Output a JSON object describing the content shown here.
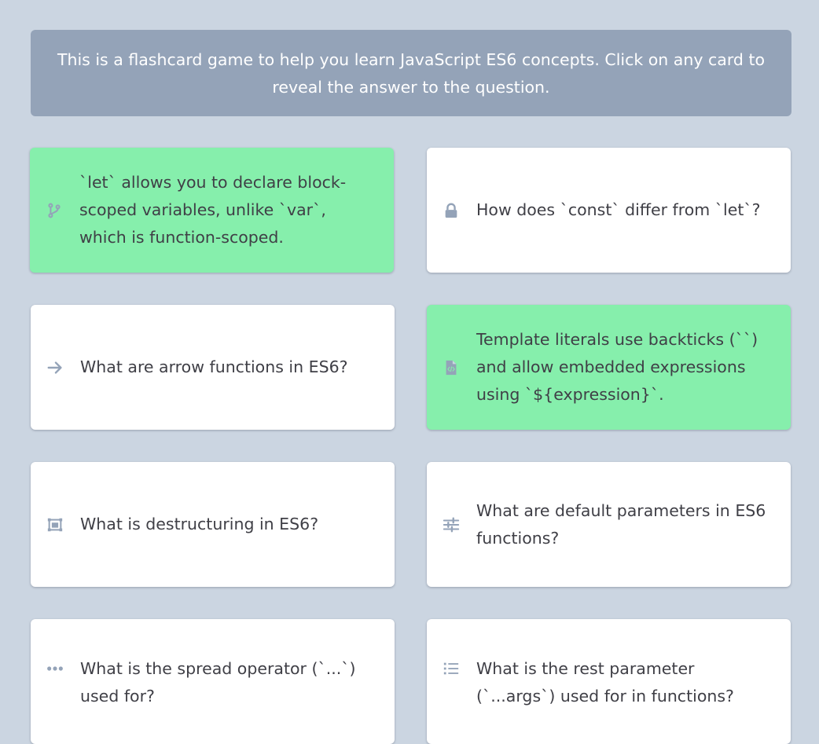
{
  "intro": {
    "text": "This is a flashcard game to help you learn JavaScript ES6 concepts. Click on any card to reveal the answer to the question."
  },
  "colors": {
    "background": "#cbd5e1",
    "banner": "#94a3b8",
    "card": "#ffffff",
    "card_revealed": "#86efac",
    "icon": "#94a3b8"
  },
  "cards": [
    {
      "icon": "git-branch-icon",
      "revealed": true,
      "text": "`let` allows you to declare block-scoped variables, unlike `var`, which is function-scoped."
    },
    {
      "icon": "lock-icon",
      "revealed": false,
      "text": "How does `const` differ from `let`?"
    },
    {
      "icon": "arrow-right-icon",
      "revealed": false,
      "text": "What are arrow functions in ES6?"
    },
    {
      "icon": "file-code-icon",
      "revealed": true,
      "text": "Template literals use backticks (``) and allow embedded expressions using `${expression}`."
    },
    {
      "icon": "object-ungroup-icon",
      "revealed": false,
      "text": "What is destructuring in ES6?"
    },
    {
      "icon": "sliders-icon",
      "revealed": false,
      "text": "What are default parameters in ES6 functions?"
    },
    {
      "icon": "ellipsis-icon",
      "revealed": false,
      "text": "What is the spread operator (`...`) used for?"
    },
    {
      "icon": "list-icon",
      "revealed": false,
      "text": "What is the rest parameter (`...args`) used for in functions?"
    }
  ]
}
